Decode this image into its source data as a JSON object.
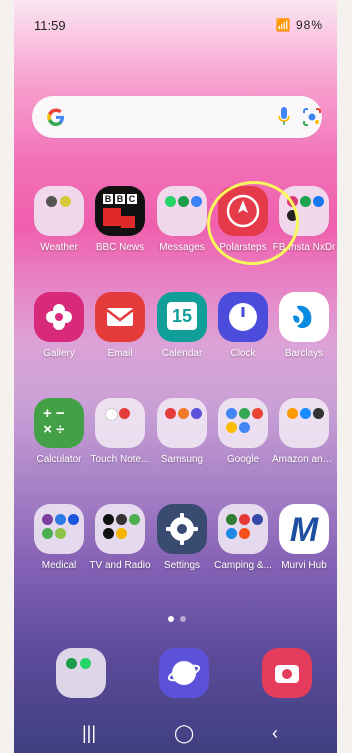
{
  "status_bar": {
    "time": "11:59",
    "battery": "98%"
  },
  "search": {
    "google_letter": "G"
  },
  "apps": [
    {
      "name": "Weather",
      "icon": "weather-folder-icon"
    },
    {
      "name": "BBC News",
      "icon": "bbc-news-icon"
    },
    {
      "name": "Messages",
      "icon": "messages-folder-icon"
    },
    {
      "name": "Polarsteps",
      "icon": "polarsteps-icon"
    },
    {
      "name": "FB Insta NxDr",
      "icon": "social-folder-icon"
    },
    {
      "name": "Gallery",
      "icon": "gallery-icon"
    },
    {
      "name": "Email",
      "icon": "email-icon"
    },
    {
      "name": "Calendar",
      "icon": "calendar-icon"
    },
    {
      "name": "Clock",
      "icon": "clock-icon"
    },
    {
      "name": "Barclays",
      "icon": "barclays-icon"
    },
    {
      "name": "Calculator",
      "icon": "calculator-icon"
    },
    {
      "name": "Touch Note...",
      "icon": "touchnote-folder-icon"
    },
    {
      "name": "Samsung",
      "icon": "samsung-folder-icon"
    },
    {
      "name": "Google",
      "icon": "google-folder-icon"
    },
    {
      "name": "Amazon and...",
      "icon": "amazon-folder-icon"
    },
    {
      "name": "Medical",
      "icon": "medical-folder-icon"
    },
    {
      "name": "TV and Radio",
      "icon": "tv-radio-folder-icon"
    },
    {
      "name": "Settings",
      "icon": "settings-icon"
    },
    {
      "name": "Camping &...",
      "icon": "camping-folder-icon"
    },
    {
      "name": "Murvi Hub",
      "icon": "murvi-hub-icon"
    }
  ],
  "calendar_day": "15",
  "murvi_letter": "M",
  "bbc_letters": [
    "B",
    "B",
    "C"
  ],
  "colors": {
    "polarsteps": "#e53a49",
    "bbc": "#111111",
    "gallery": "#d8297b",
    "email": "#e53b3b",
    "calendar": "#119e99",
    "clock": "#4c4cdc",
    "barclays": "#0a8be2",
    "calculator": "#43a047",
    "settings": "#3a4b72",
    "highlight": "#f8f85b"
  }
}
